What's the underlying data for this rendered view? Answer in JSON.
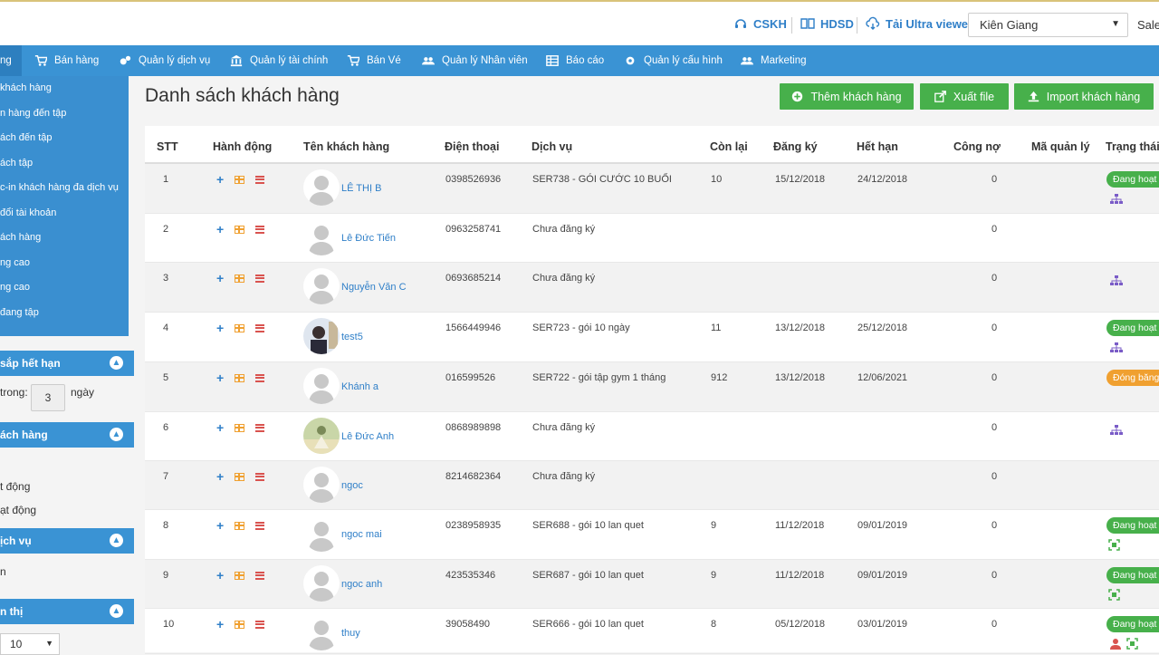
{
  "topbar": {
    "cskh": "CSKH",
    "hdsd": "HDSD",
    "ultraviewer": "Tải Ultra viewer",
    "region": "Kiên Giang",
    "sales": "Sales"
  },
  "nav": {
    "items": [
      {
        "label": "ng"
      },
      {
        "label": "Bán hàng"
      },
      {
        "label": "Quản lý dịch vụ"
      },
      {
        "label": "Quản lý tài chính"
      },
      {
        "label": "Bán Vé"
      },
      {
        "label": "Quản lý Nhân viên"
      },
      {
        "label": "Báo cáo"
      },
      {
        "label": "Quản lý cấu hình"
      },
      {
        "label": "Marketing"
      }
    ]
  },
  "sidebar": {
    "submenu": [
      "khách hàng",
      "n hàng đến tập",
      "ách đến tập",
      "ách tập",
      "c-in khách hàng đa dịch vụ",
      "đổi tài khoản",
      "ách hàng",
      "ng cao",
      "ng cao",
      "đang tập"
    ],
    "panel_expiring": "sắp hết hạn",
    "within_label": "trong:",
    "days_value": "3",
    "days_unit": "ngày",
    "panel_customers": "ách hàng",
    "status_active": "t động",
    "status_inactive": "ạt động",
    "panel_services": "ịch vụ",
    "services_text": "n",
    "panel_display": "n thị",
    "page_size": "10"
  },
  "page": {
    "title": "Danh sách khách hàng",
    "btn_add": "Thêm khách hàng",
    "btn_export": "Xuất file",
    "btn_import": "Import khách hàng"
  },
  "table": {
    "headers": {
      "stt": "STT",
      "action": "Hành động",
      "name": "Tên khách hàng",
      "phone": "Điện thoại",
      "service": "Dịch vụ",
      "remaining": "Còn lại",
      "registered": "Đăng ký",
      "expires": "Hết hạn",
      "debt": "Công nợ",
      "manager_code": "Mã quản lý",
      "status": "Trạng thái"
    },
    "rows": [
      {
        "stt": "1",
        "name": "LÊ THỊ B",
        "phone": "0398526936",
        "service": "SER738 - GÓI CƯỚC 10 BUỔI",
        "remaining": "10",
        "registered": "15/12/2018",
        "expires": "24/12/2018",
        "debt": "0",
        "status": "Đang hoạt động"
      },
      {
        "stt": "2",
        "name": "Lê Đức Tiến",
        "phone": "0963258741",
        "service": "Chưa đăng ký",
        "remaining": "",
        "registered": "",
        "expires": "",
        "debt": "0",
        "status": ""
      },
      {
        "stt": "3",
        "name": "Nguyễn Văn C",
        "phone": "0693685214",
        "service": "Chưa đăng ký",
        "remaining": "",
        "registered": "",
        "expires": "",
        "debt": "0",
        "status": ""
      },
      {
        "stt": "4",
        "name": "test5",
        "phone": "1566449946",
        "service": "SER723 - gói 10 ngày",
        "remaining": "11",
        "registered": "13/12/2018",
        "expires": "25/12/2018",
        "debt": "0",
        "status": "Đang hoạt động"
      },
      {
        "stt": "5",
        "name": "Khánh a",
        "phone": "016599526",
        "service": "SER722 - gói tập gym 1 tháng",
        "remaining": "912",
        "registered": "13/12/2018",
        "expires": "12/06/2021",
        "debt": "0",
        "status": "Đóng băng"
      },
      {
        "stt": "6",
        "name": "Lê Đức Anh",
        "phone": "0868989898",
        "service": "Chưa đăng ký",
        "remaining": "",
        "registered": "",
        "expires": "",
        "debt": "0",
        "status": ""
      },
      {
        "stt": "7",
        "name": "ngoc",
        "phone": "8214682364",
        "service": "Chưa đăng ký",
        "remaining": "",
        "registered": "",
        "expires": "",
        "debt": "0",
        "status": ""
      },
      {
        "stt": "8",
        "name": "ngoc mai",
        "phone": "0238958935",
        "service": "SER688 - gói 10 lan quet",
        "remaining": "9",
        "registered": "11/12/2018",
        "expires": "09/01/2019",
        "debt": "0",
        "status": "Đang hoạt động"
      },
      {
        "stt": "9",
        "name": "ngoc anh",
        "phone": "423535346",
        "service": "SER687 - gói 10 lan quet",
        "remaining": "9",
        "registered": "11/12/2018",
        "expires": "09/01/2019",
        "debt": "0",
        "status": "Đang hoạt động"
      },
      {
        "stt": "10",
        "name": "thuy",
        "phone": "39058490",
        "service": "SER666 - gói 10 lan quet",
        "remaining": "8",
        "registered": "05/12/2018",
        "expires": "03/01/2019",
        "debt": "0",
        "status": "Đang hoạt động"
      }
    ]
  },
  "colors": {
    "nav": "#3a93d4",
    "button_green": "#47b04b",
    "link_blue": "#2f7fc8",
    "badge_orange": "#f0a030"
  }
}
